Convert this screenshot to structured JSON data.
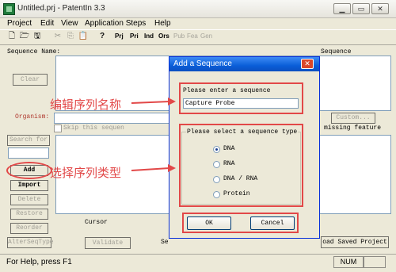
{
  "window": {
    "title": "Untitled.prj - PatentIn 3.3",
    "min": "▁",
    "max": "▭",
    "close": "✕"
  },
  "menu": [
    "Project",
    "Edit",
    "View",
    "Application Steps",
    "Help"
  ],
  "toolbar": {
    "new": "🗋",
    "open": "🗁",
    "save": "🖫",
    "cut": "✂",
    "copy": "⎘",
    "paste": "📋",
    "help": "?",
    "prj": "Prj",
    "pri": "Pri",
    "ind": "Ind",
    "ors": "Ors",
    "pub": "Pub",
    "fea": "Fea",
    "gen": "Gen"
  },
  "main": {
    "sequence_name_label": "Sequence Name:",
    "sequence_label": "Sequence",
    "clear_button": "Clear",
    "organism_label": "Organism:",
    "skip_label": "Skip this sequen",
    "search_label": "Search for",
    "add_button": "Add",
    "import_button": "Import",
    "delete_button": "Delete",
    "restore_button": "Restore",
    "reorder_button": "Reorder",
    "alterseq_button": "AlterSeqType",
    "cursor_label": "Cursor",
    "validate_button": "Validate",
    "se_fragment": "Se",
    "custom_button": "Custom...",
    "missing_feature": "missing feature",
    "load_saved_button": "oad Saved Project"
  },
  "status": {
    "help": "For Help, press F1",
    "num": "NUM"
  },
  "dialog": {
    "title": "Add a Sequence",
    "close": "✕",
    "enter_label": "Please enter a sequence",
    "sequence_value": "Capture Probe",
    "type_group_label": "Please select a sequence type",
    "options": [
      "DNA",
      "RNA",
      "DNA / RNA",
      "Protein"
    ],
    "selected_option": "DNA",
    "ok_button": "OK",
    "cancel_button": "Cancel"
  },
  "annotations": {
    "edit_name": "编辑序列名称",
    "select_type": "选择序列类型",
    "color": "#e24848"
  }
}
